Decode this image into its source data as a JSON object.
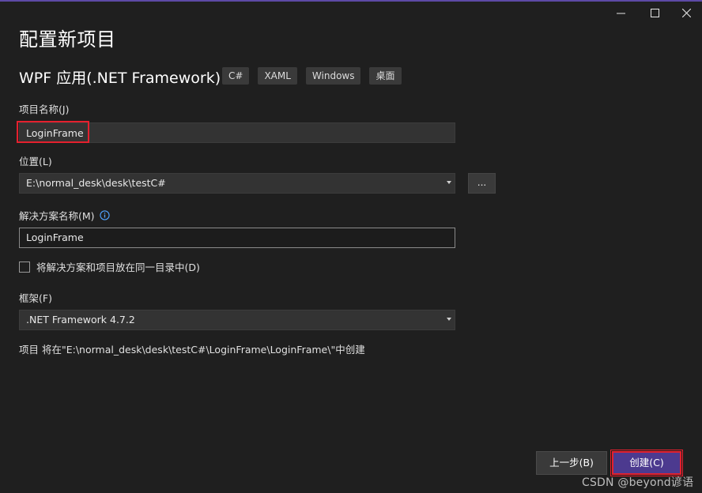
{
  "dialog": {
    "title": "配置新项目",
    "template_name": "WPF 应用(.NET Framework)",
    "tags": [
      "C#",
      "XAML",
      "Windows",
      "桌面"
    ]
  },
  "form": {
    "project_name_label": "项目名称(J)",
    "project_name_value": "LoginFrame",
    "location_label": "位置(L)",
    "location_value": "E:\\normal_desk\\desk\\testC#",
    "browse_label": "...",
    "solution_name_label": "解决方案名称(M)",
    "solution_name_value": "LoginFrame",
    "same_dir_label": "将解决方案和项目放在同一目录中(D)",
    "same_dir_checked": false,
    "framework_label": "框架(F)",
    "framework_value": ".NET Framework 4.7.2",
    "path_summary": "项目 将在\"E:\\normal_desk\\desk\\testC#\\LoginFrame\\LoginFrame\\\"中创建"
  },
  "buttons": {
    "back": "上一步(B)",
    "create": "创建(C)"
  },
  "watermark": "CSDN @beyond谚语",
  "icons": {
    "minimize": "minimize-icon",
    "maximize": "maximize-icon",
    "close": "close-icon",
    "info": "info-icon",
    "dropdown": "chevron-down-icon"
  },
  "colors": {
    "accent": "#4c3a8f",
    "highlight": "#e5202e",
    "background": "#1f1f1f",
    "info": "#4fa3ff"
  }
}
